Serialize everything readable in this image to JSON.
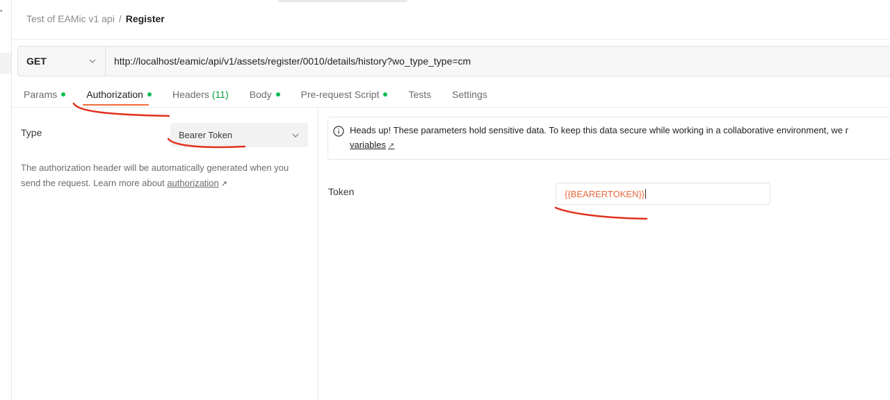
{
  "breadcrumb": {
    "parent": "Test of EAMic v1 api",
    "separator": "/",
    "current": "Register"
  },
  "request": {
    "method": "GET",
    "url": "http://localhost/eamic/api/v1/assets/register/0010/details/history?wo_type_type=cm"
  },
  "tabs": [
    {
      "label": "Params",
      "dot": true
    },
    {
      "label": "Authorization",
      "dot": true,
      "active": true
    },
    {
      "label": "Headers",
      "count": "(11)"
    },
    {
      "label": "Body",
      "dot": true
    },
    {
      "label": "Pre-request Script",
      "dot": true
    },
    {
      "label": "Tests"
    },
    {
      "label": "Settings"
    }
  ],
  "auth": {
    "type_label": "Type",
    "type_value": "Bearer Token",
    "description": "The authorization header will be automatically generated when you send the request. Learn more about",
    "learn_more_link": "authorization"
  },
  "notice": {
    "text": "Heads up! These parameters hold sensitive data. To keep this data secure while working in a collaborative environment, we r",
    "link": "variables"
  },
  "token": {
    "label": "Token",
    "value": "{{BEARERTOKEN}}"
  },
  "colors": {
    "accent": "#f26b3a",
    "status_dot": "#0cbb52",
    "token_text": "#e8693c",
    "annotation_red": "#e0301e"
  },
  "icons": {
    "external_link": "arrow-up-right-icon",
    "info": "info-circle-icon",
    "dropdown": "chevron-down-icon"
  }
}
